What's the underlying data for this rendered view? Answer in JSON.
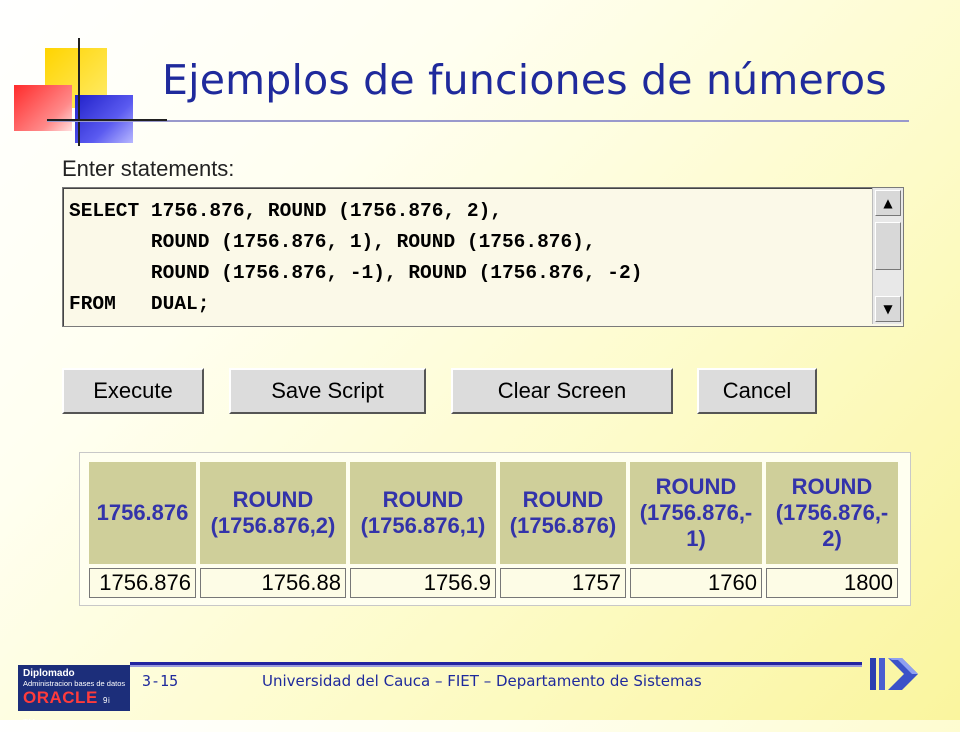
{
  "slide": {
    "title": "Ejemplos de funciones de números",
    "slide_number": "3-15",
    "footer": "Universidad del Cauca – FIET – Departamento de Sistemas"
  },
  "editor": {
    "label": "Enter statements:",
    "sql": "SELECT 1756.876, ROUND (1756.876, 2),\n       ROUND (1756.876, 1), ROUND (1756.876),\n       ROUND (1756.876, -1), ROUND (1756.876, -2)\nFROM   DUAL;"
  },
  "buttons": {
    "execute": "Execute",
    "save_script": "Save Script",
    "clear_screen": "Clear Screen",
    "cancel": "Cancel"
  },
  "result": {
    "headers": [
      "1756.876",
      "ROUND (1756.876,2)",
      "ROUND (1756.876,1)",
      "ROUND (1756.876)",
      "ROUND (1756.876,- 1)",
      "ROUND (1756.876,- 2)"
    ],
    "rows": [
      [
        "1756.876",
        "1756.88",
        "1756.9",
        "1757",
        "1760",
        "1800"
      ]
    ]
  },
  "logo": {
    "line1": "Diplomado",
    "line2": "Administracion bases de datos",
    "brand": "ORACLE",
    "suffix": "9i TM"
  },
  "colors": {
    "title": "#1f2a9c",
    "header_bg": "#cfcf9a",
    "header_text": "#3333aa"
  }
}
